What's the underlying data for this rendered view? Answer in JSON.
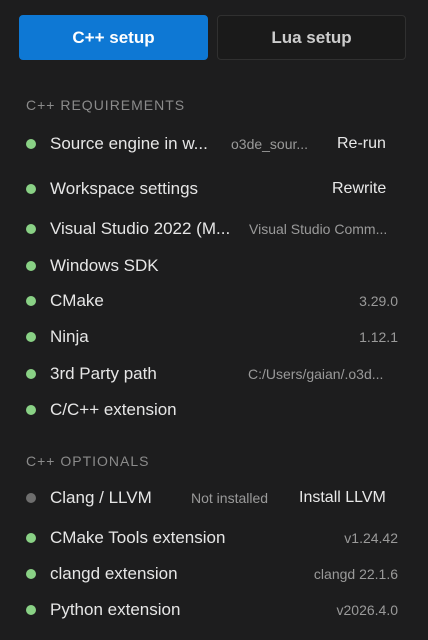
{
  "tabs": {
    "cpp": "C++ setup",
    "lua": "Lua setup"
  },
  "requirements": {
    "title": "C++ REQUIREMENTS",
    "items": [
      {
        "label": "Source engine in w...",
        "detail": "o3de_sour...",
        "action": "Re-run",
        "status": "ok"
      },
      {
        "label": "Workspace settings",
        "detail": "",
        "action": "Rewrite",
        "status": "ok"
      },
      {
        "label": "Visual Studio 2022 (M...",
        "detail": "Visual Studio Comm...",
        "action": "",
        "status": "ok"
      },
      {
        "label": "Windows SDK",
        "detail": "",
        "action": "",
        "status": "ok"
      },
      {
        "label": "CMake",
        "detail": "3.29.0",
        "action": "",
        "status": "ok"
      },
      {
        "label": "Ninja",
        "detail": "1.12.1",
        "action": "",
        "status": "ok"
      },
      {
        "label": "3rd Party path",
        "detail": "C:/Users/gaian/.o3d...",
        "action": "",
        "status": "ok"
      },
      {
        "label": "C/C++ extension",
        "detail": "",
        "action": "",
        "status": "ok"
      }
    ]
  },
  "optionals": {
    "title": "C++ OPTIONALS",
    "items": [
      {
        "label": "Clang / LLVM",
        "detail": "Not installed",
        "action": "Install LLVM",
        "status": "missing"
      },
      {
        "label": "CMake Tools extension",
        "detail": "v1.24.42",
        "action": "",
        "status": "ok"
      },
      {
        "label": "clangd extension",
        "detail": "clangd 22.1.6",
        "action": "",
        "status": "ok"
      },
      {
        "label": "Python extension",
        "detail": "v2026.4.0",
        "action": "",
        "status": "ok"
      }
    ]
  },
  "colors": {
    "accent": "#0e78d4",
    "ok": "#89d185",
    "missing": "#6e6e6e"
  }
}
